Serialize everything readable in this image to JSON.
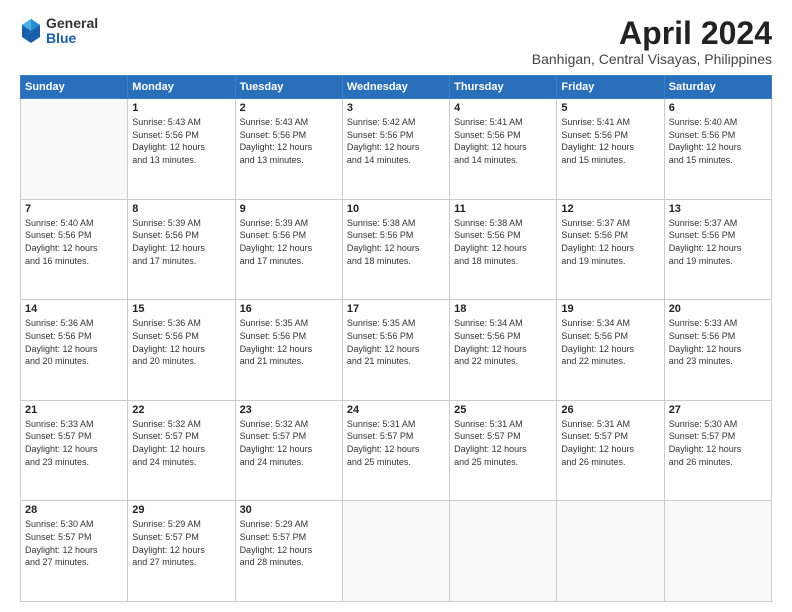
{
  "logo": {
    "general": "General",
    "blue": "Blue"
  },
  "title": "April 2024",
  "location": "Banhigan, Central Visayas, Philippines",
  "calendar": {
    "headers": [
      "Sunday",
      "Monday",
      "Tuesday",
      "Wednesday",
      "Thursday",
      "Friday",
      "Saturday"
    ],
    "weeks": [
      [
        {
          "day": "",
          "text": ""
        },
        {
          "day": "1",
          "text": "Sunrise: 5:43 AM\nSunset: 5:56 PM\nDaylight: 12 hours\nand 13 minutes."
        },
        {
          "day": "2",
          "text": "Sunrise: 5:43 AM\nSunset: 5:56 PM\nDaylight: 12 hours\nand 13 minutes."
        },
        {
          "day": "3",
          "text": "Sunrise: 5:42 AM\nSunset: 5:56 PM\nDaylight: 12 hours\nand 14 minutes."
        },
        {
          "day": "4",
          "text": "Sunrise: 5:41 AM\nSunset: 5:56 PM\nDaylight: 12 hours\nand 14 minutes."
        },
        {
          "day": "5",
          "text": "Sunrise: 5:41 AM\nSunset: 5:56 PM\nDaylight: 12 hours\nand 15 minutes."
        },
        {
          "day": "6",
          "text": "Sunrise: 5:40 AM\nSunset: 5:56 PM\nDaylight: 12 hours\nand 15 minutes."
        }
      ],
      [
        {
          "day": "7",
          "text": "Sunrise: 5:40 AM\nSunset: 5:56 PM\nDaylight: 12 hours\nand 16 minutes."
        },
        {
          "day": "8",
          "text": "Sunrise: 5:39 AM\nSunset: 5:56 PM\nDaylight: 12 hours\nand 17 minutes."
        },
        {
          "day": "9",
          "text": "Sunrise: 5:39 AM\nSunset: 5:56 PM\nDaylight: 12 hours\nand 17 minutes."
        },
        {
          "day": "10",
          "text": "Sunrise: 5:38 AM\nSunset: 5:56 PM\nDaylight: 12 hours\nand 18 minutes."
        },
        {
          "day": "11",
          "text": "Sunrise: 5:38 AM\nSunset: 5:56 PM\nDaylight: 12 hours\nand 18 minutes."
        },
        {
          "day": "12",
          "text": "Sunrise: 5:37 AM\nSunset: 5:56 PM\nDaylight: 12 hours\nand 19 minutes."
        },
        {
          "day": "13",
          "text": "Sunrise: 5:37 AM\nSunset: 5:56 PM\nDaylight: 12 hours\nand 19 minutes."
        }
      ],
      [
        {
          "day": "14",
          "text": "Sunrise: 5:36 AM\nSunset: 5:56 PM\nDaylight: 12 hours\nand 20 minutes."
        },
        {
          "day": "15",
          "text": "Sunrise: 5:36 AM\nSunset: 5:56 PM\nDaylight: 12 hours\nand 20 minutes."
        },
        {
          "day": "16",
          "text": "Sunrise: 5:35 AM\nSunset: 5:56 PM\nDaylight: 12 hours\nand 21 minutes."
        },
        {
          "day": "17",
          "text": "Sunrise: 5:35 AM\nSunset: 5:56 PM\nDaylight: 12 hours\nand 21 minutes."
        },
        {
          "day": "18",
          "text": "Sunrise: 5:34 AM\nSunset: 5:56 PM\nDaylight: 12 hours\nand 22 minutes."
        },
        {
          "day": "19",
          "text": "Sunrise: 5:34 AM\nSunset: 5:56 PM\nDaylight: 12 hours\nand 22 minutes."
        },
        {
          "day": "20",
          "text": "Sunrise: 5:33 AM\nSunset: 5:56 PM\nDaylight: 12 hours\nand 23 minutes."
        }
      ],
      [
        {
          "day": "21",
          "text": "Sunrise: 5:33 AM\nSunset: 5:57 PM\nDaylight: 12 hours\nand 23 minutes."
        },
        {
          "day": "22",
          "text": "Sunrise: 5:32 AM\nSunset: 5:57 PM\nDaylight: 12 hours\nand 24 minutes."
        },
        {
          "day": "23",
          "text": "Sunrise: 5:32 AM\nSunset: 5:57 PM\nDaylight: 12 hours\nand 24 minutes."
        },
        {
          "day": "24",
          "text": "Sunrise: 5:31 AM\nSunset: 5:57 PM\nDaylight: 12 hours\nand 25 minutes."
        },
        {
          "day": "25",
          "text": "Sunrise: 5:31 AM\nSunset: 5:57 PM\nDaylight: 12 hours\nand 25 minutes."
        },
        {
          "day": "26",
          "text": "Sunrise: 5:31 AM\nSunset: 5:57 PM\nDaylight: 12 hours\nand 26 minutes."
        },
        {
          "day": "27",
          "text": "Sunrise: 5:30 AM\nSunset: 5:57 PM\nDaylight: 12 hours\nand 26 minutes."
        }
      ],
      [
        {
          "day": "28",
          "text": "Sunrise: 5:30 AM\nSunset: 5:57 PM\nDaylight: 12 hours\nand 27 minutes."
        },
        {
          "day": "29",
          "text": "Sunrise: 5:29 AM\nSunset: 5:57 PM\nDaylight: 12 hours\nand 27 minutes."
        },
        {
          "day": "30",
          "text": "Sunrise: 5:29 AM\nSunset: 5:57 PM\nDaylight: 12 hours\nand 28 minutes."
        },
        {
          "day": "",
          "text": ""
        },
        {
          "day": "",
          "text": ""
        },
        {
          "day": "",
          "text": ""
        },
        {
          "day": "",
          "text": ""
        }
      ]
    ]
  }
}
